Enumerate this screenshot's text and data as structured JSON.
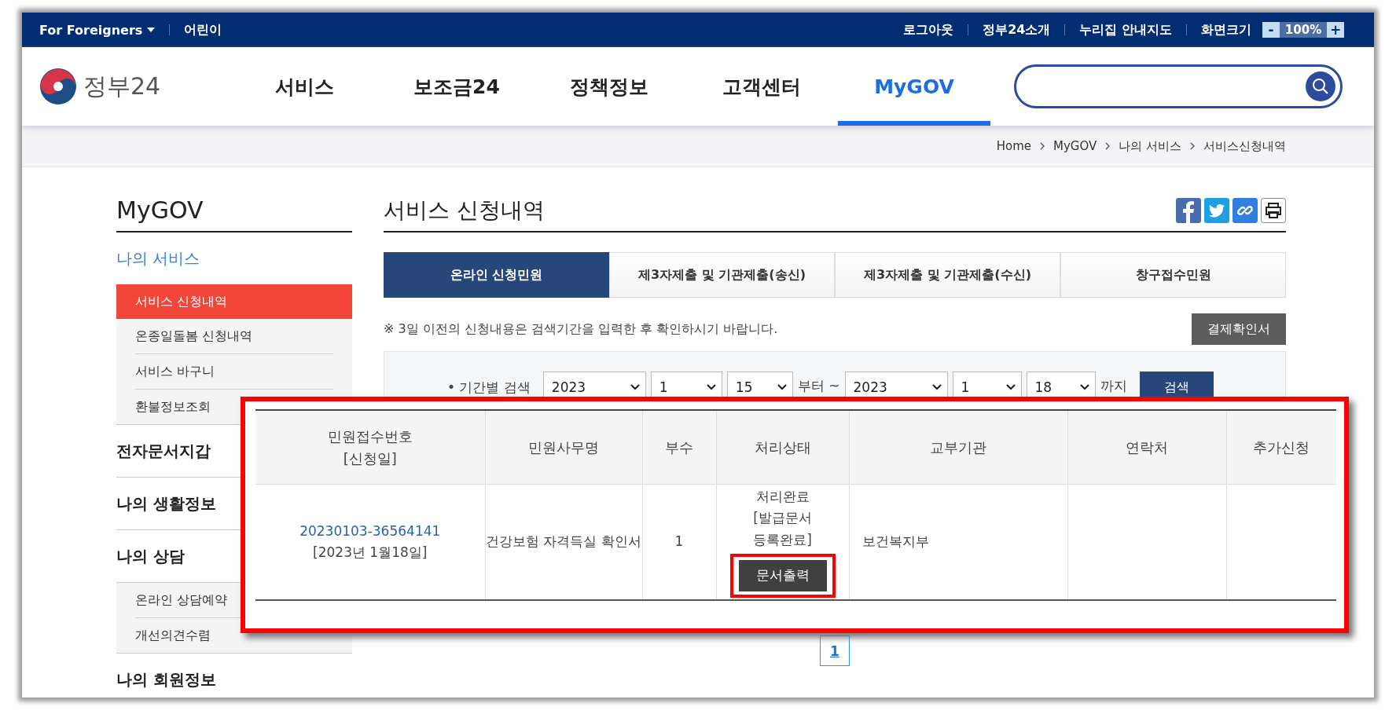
{
  "top_bar": {
    "language": "For Foreigners",
    "left_links": [
      "어린이"
    ],
    "right_links": [
      "로그아웃",
      "정부24소개",
      "누리집 안내지도"
    ],
    "zoom": {
      "label": "화면크기",
      "minus": "-",
      "value": "100%",
      "plus": "+"
    }
  },
  "header": {
    "logo_text": "정부24",
    "nav": [
      {
        "label": "서비스",
        "selected": false
      },
      {
        "label": "보조금24",
        "selected": false
      },
      {
        "label": "정책정보",
        "selected": false
      },
      {
        "label": "고객센터",
        "selected": false
      },
      {
        "label": "MyGOV",
        "selected": true
      }
    ]
  },
  "breadcrumb": [
    "Home",
    "MyGOV",
    "나의 서비스",
    "서비스신청내역"
  ],
  "sidebar": {
    "title": "MyGOV",
    "sections": [
      {
        "label": "나의 서비스",
        "selected": true,
        "children": [
          {
            "label": "서비스 신청내역",
            "selected": true
          },
          {
            "label": "온종일돌봄 신청내역",
            "selected": false
          },
          {
            "label": "서비스 바구니",
            "selected": false
          },
          {
            "label": "환불정보조회",
            "selected": false
          }
        ]
      },
      {
        "label": "전자문서지갑",
        "selected": false
      },
      {
        "label": "나의 생활정보",
        "selected": false
      },
      {
        "label": "나의 상담",
        "selected": false,
        "children": [
          {
            "label": "온라인 상담예약",
            "selected": false
          },
          {
            "label": "개선의견수렴",
            "selected": false
          }
        ]
      },
      {
        "label": "나의 회원정보",
        "selected": false
      }
    ]
  },
  "main": {
    "title": "서비스 신청내역",
    "tabs": [
      {
        "label": "온라인 신청민원",
        "selected": true
      },
      {
        "label": "제3자제출 및 기관제출(송신)",
        "selected": false
      },
      {
        "label": "제3자제출 및 기관제출(수신)",
        "selected": false
      },
      {
        "label": "창구접수민원",
        "selected": false
      }
    ],
    "notice": "※ 3일 이전의 신청내용은 검색기간을 입력한 후 확인하시기 바랍니다.",
    "receipt_button": "결제확인서",
    "period_search": {
      "label": "• 기간별 검색",
      "from": [
        "2023",
        "1",
        "15"
      ],
      "from_suffix": "부터 ~",
      "to": [
        "2023",
        "1",
        "18"
      ],
      "to_suffix": "까지",
      "button": "검색"
    },
    "pagination": [
      {
        "label": "1",
        "selected": true
      }
    ]
  },
  "overlay": {
    "columns": [
      {
        "label": "민원접수번호",
        "sub": "[신청일]"
      },
      {
        "label": "민원사무명"
      },
      {
        "label": "부수"
      },
      {
        "label": "처리상태"
      },
      {
        "label": "교부기관"
      },
      {
        "label": "연락처"
      },
      {
        "label": "추가신청"
      }
    ],
    "rows": [
      {
        "number": "20230103-36564141",
        "date": "[2023년 1월18일]",
        "name": "건강보험 자격득실 확인서",
        "copies": "1",
        "status": "처리완료",
        "status_detail": "[발급문서 등록완료]",
        "button": "문서출력",
        "button_highlighted": true,
        "agency": "보건복지부"
      }
    ]
  }
}
